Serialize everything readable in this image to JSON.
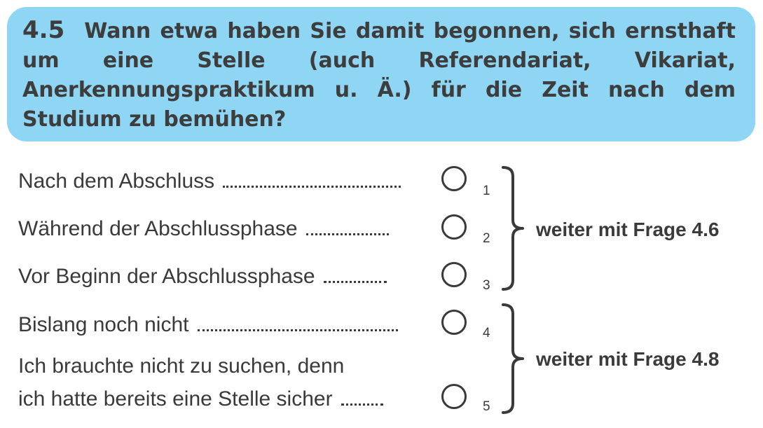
{
  "question": {
    "number": "4.5",
    "text": "Wann etwa haben Sie damit begonnen, sich ernsthaft um eine Stelle (auch Referendariat, Vikariat, Anerkennungspraktikum u. Ä.) für die Zeit nach dem Studium zu bemühen?"
  },
  "options": [
    {
      "label": "Nach dem Abschluss",
      "code": "1"
    },
    {
      "label": "Während der Abschlussphase",
      "code": "2"
    },
    {
      "label": "Vor Beginn der Abschlussphase",
      "code": "3"
    },
    {
      "label": "Bislang noch nicht",
      "code": "4"
    },
    {
      "label_line1": "Ich brauchte nicht zu suchen, denn",
      "label_line2": "ich hatte bereits eine Stelle sicher",
      "code": "5"
    }
  ],
  "skips": [
    {
      "label": "weiter mit Frage 4.6"
    },
    {
      "label": "weiter mit Frage 4.8"
    }
  ],
  "colors": {
    "question_background": "#8fd6f5",
    "text": "#3a3a3a"
  }
}
